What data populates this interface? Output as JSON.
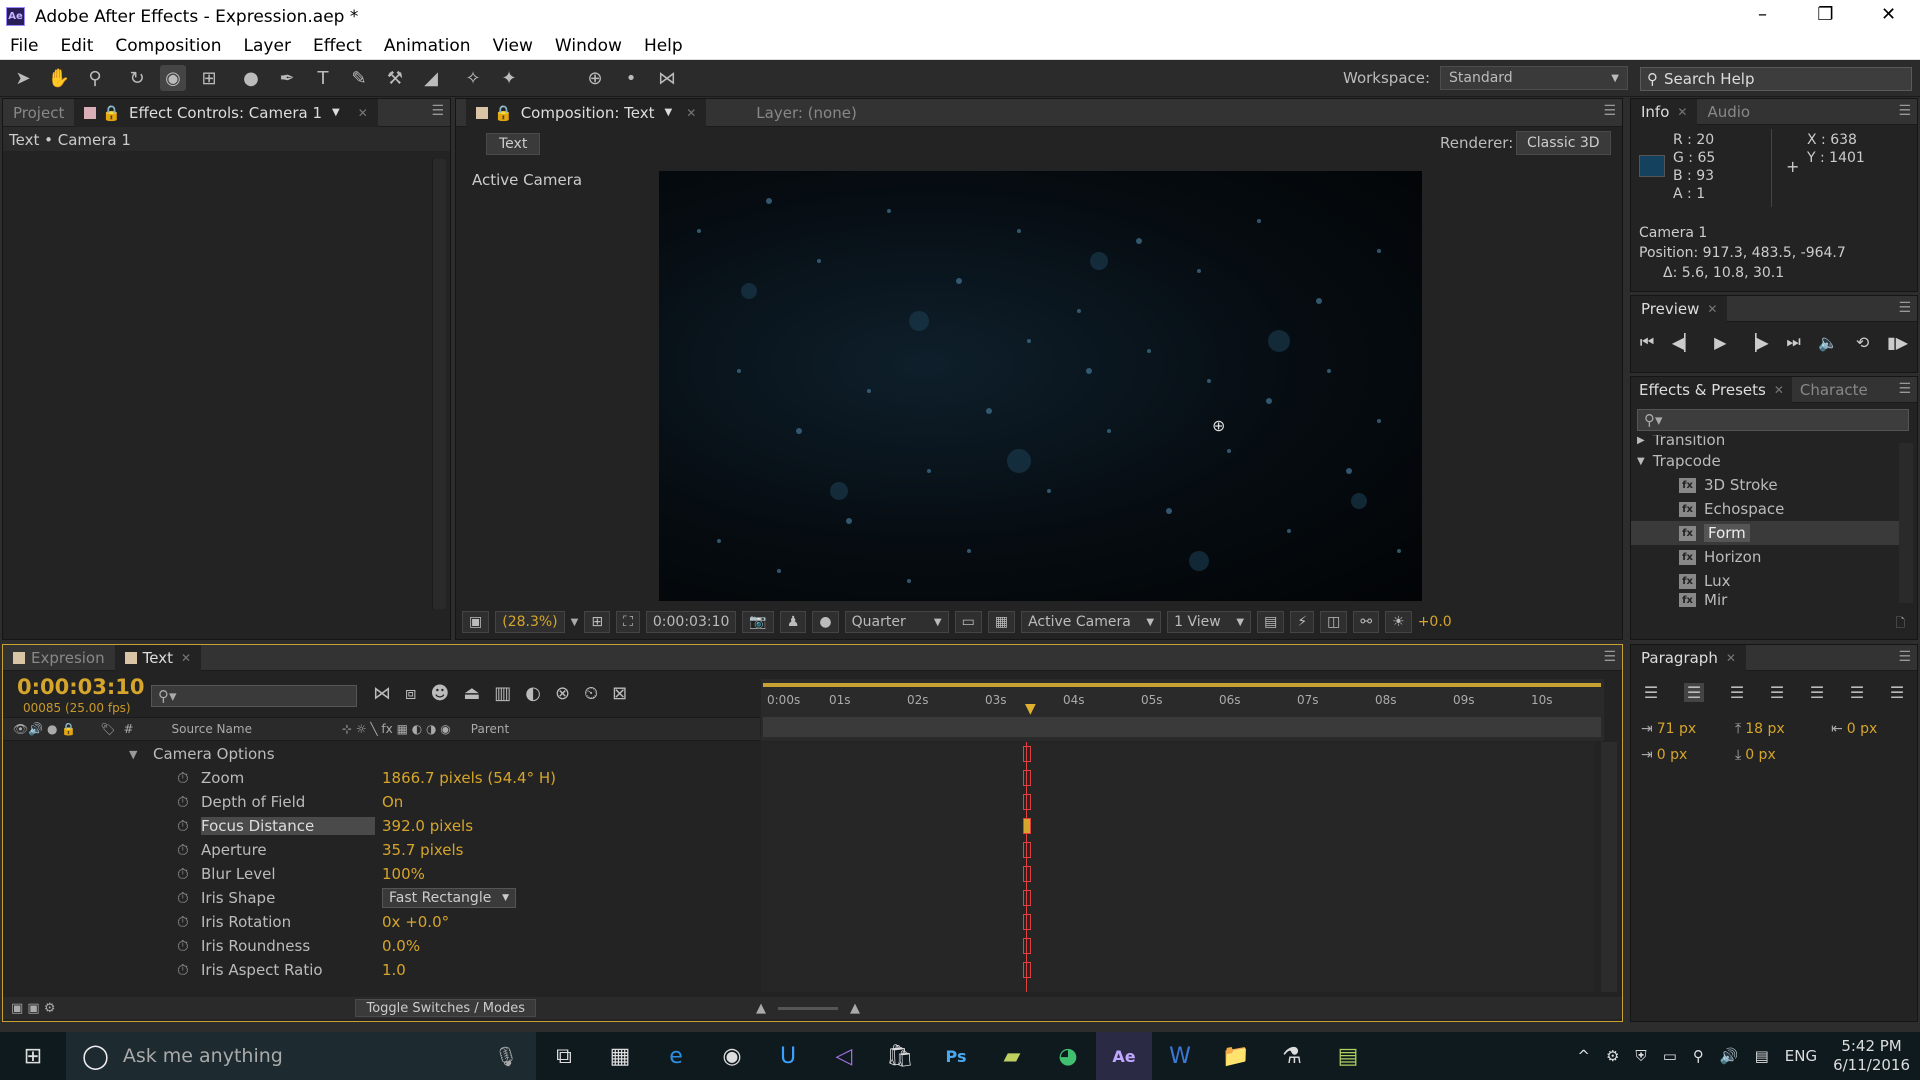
{
  "app": {
    "title": "Adobe After Effects - Expression.aep *",
    "logo_text": "Ae",
    "window_controls": [
      "–",
      "❐",
      "✕"
    ]
  },
  "menu": [
    "File",
    "Edit",
    "Composition",
    "Layer",
    "Effect",
    "Animation",
    "View",
    "Window",
    "Help"
  ],
  "toolbar": {
    "tools": [
      "selection-tool",
      "hand-tool",
      "zoom-tool",
      "rotation-tool",
      "unified-camera-tool",
      "pan-behind-tool",
      "mask-tool",
      "pen-tool",
      "type-tool",
      "brush-tool",
      "clone-stamp-tool",
      "eraser-tool",
      "roto-brush-tool",
      "puppet-tool"
    ],
    "workspace_label": "Workspace:",
    "workspace_value": "Standard",
    "search_placeholder": "Search Help"
  },
  "left_panel": {
    "tabs": [
      "Project",
      "Effect Controls: Camera 1"
    ],
    "breadcrumb": "Text • Camera 1"
  },
  "comp_panel": {
    "tab_label": "Composition: Text",
    "layer_tab": "Layer: (none)",
    "comp_name_tab": "Text",
    "renderer_label": "Renderer:",
    "renderer_value": "Classic 3D",
    "active_camera_label": "Active Camera",
    "footer": {
      "zoom": "(28.3%)",
      "timecode": "0:00:03:10",
      "resolution": "Quarter",
      "view": "Active Camera",
      "views_count": "1 View",
      "exposure": "+0.0"
    }
  },
  "info_panel": {
    "tabs": [
      "Info",
      "Audio"
    ],
    "r": "R : 20",
    "g": "G : 65",
    "b": "B : 93",
    "a": "A : 1",
    "x": "X : 638",
    "y": "Y : 1401",
    "swatch_color": "#14415d",
    "layer_name": "Camera 1",
    "position": "Position: 917.3, 483.5, -964.7",
    "delta": "Δ: 5.6, 10.8, 30.1"
  },
  "preview_panel": {
    "tab": "Preview"
  },
  "effects_panel": {
    "tabs": [
      "Effects & Presets",
      "Characte"
    ],
    "category_collapsed": "Transition",
    "category_open": "Trapcode",
    "items": [
      "3D Stroke",
      "Echospace",
      "Form",
      "Horizon",
      "Lux",
      "Mir"
    ],
    "selected": "Form"
  },
  "paragraph_panel": {
    "tab": "Paragraph",
    "indent_left": "71 px",
    "space_before": "18 px",
    "indent_right": "0 px",
    "indent_first": "0 px",
    "space_after": "0 px"
  },
  "timeline": {
    "tabs": [
      "Expresion",
      "Text"
    ],
    "timecode": "0:00:03:10",
    "frames": "00085 (25.00 fps)",
    "columns": {
      "source_name": "Source Name",
      "parent": "Parent",
      "hash": "#"
    },
    "ruler": [
      "0:00s",
      "01s",
      "02s",
      "03s",
      "04s",
      "05s",
      "06s",
      "07s",
      "08s",
      "09s",
      "10s"
    ],
    "group": "Camera Options",
    "properties": [
      {
        "name": "Zoom",
        "value": "1866.7 pixels (54.4° H)"
      },
      {
        "name": "Depth of Field",
        "value": "On"
      },
      {
        "name": "Focus Distance",
        "value": "392.0 pixels"
      },
      {
        "name": "Aperture",
        "value": "35.7 pixels"
      },
      {
        "name": "Blur Level",
        "value": "100%"
      },
      {
        "name": "Iris Shape",
        "value": "Fast Rectangle"
      },
      {
        "name": "Iris Rotation",
        "value": "0x +0.0°"
      },
      {
        "name": "Iris Roundness",
        "value": "0.0%"
      },
      {
        "name": "Iris Aspect Ratio",
        "value": "1.0"
      }
    ],
    "toggle_label": "Toggle Switches / Modes"
  },
  "taskbar": {
    "search_placeholder": "Ask me anything",
    "language": "ENG",
    "time": "5:42 PM",
    "date": "6/11/2016"
  }
}
